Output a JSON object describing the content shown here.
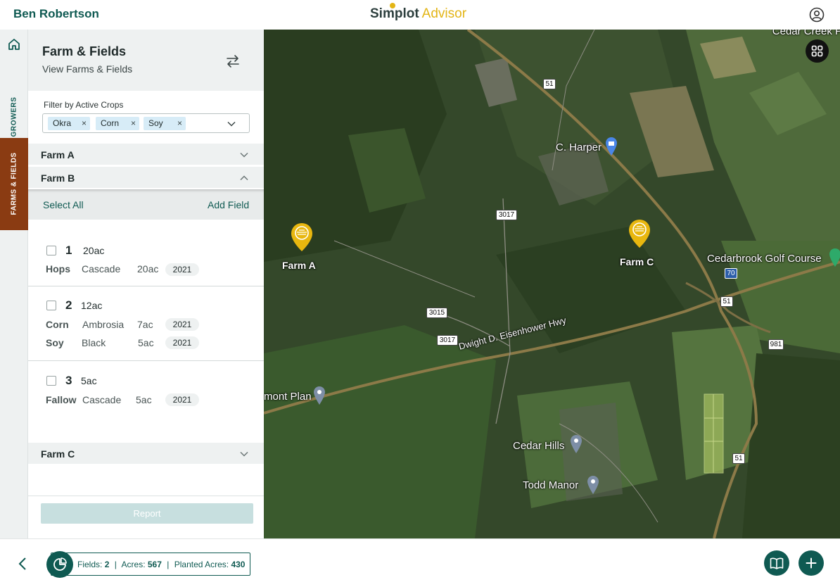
{
  "header": {
    "user_name": "Ben Robertson",
    "brand_primary": "Simplot",
    "brand_secondary": "Advisor",
    "profile_icon": "user-circle-icon"
  },
  "rail": {
    "home_icon": "home-icon",
    "growers_label": "GROWERS",
    "farms_fields_label": "FARMS & FIELDS"
  },
  "panel": {
    "title": "Farm & Fields",
    "subtitle": "View Farms & Fields",
    "swap_icon": "swap-arrows-icon",
    "filter_label": "Filter by Active Crops",
    "filter_chips": [
      "Okra",
      "Corn",
      "Soy"
    ],
    "chip_remove": "×",
    "farms": [
      {
        "name": "Farm A",
        "expanded": false
      },
      {
        "name": "Farm B",
        "expanded": true
      },
      {
        "name": "Farm C",
        "expanded": false
      }
    ],
    "select_all": "Select All",
    "add_field": "Add Field",
    "fields": [
      {
        "number": "1",
        "acres": "20ac",
        "crops": [
          {
            "crop": "Hops",
            "variety": "Cascade",
            "acres": "20ac",
            "year": "2021"
          }
        ]
      },
      {
        "number": "2",
        "acres": "12ac",
        "crops": [
          {
            "crop": "Corn",
            "variety": "Ambrosia",
            "acres": "7ac",
            "year": "2021"
          },
          {
            "crop": "Soy",
            "variety": "Black",
            "acres": "5ac",
            "year": "2021"
          }
        ]
      },
      {
        "number": "3",
        "acres": "5ac",
        "crops": [
          {
            "crop": "Fallow",
            "variety": "Cascade",
            "acres": "5ac",
            "year": "2021"
          }
        ]
      }
    ],
    "report_label": "Report"
  },
  "map": {
    "farm_markers": [
      "Farm A",
      "Farm C"
    ],
    "places": {
      "cedar_creek": "Cedar Creek P",
      "c_harper": "C. Harper",
      "cedarbrook": "Cedarbrook Golf Course",
      "mont_plan": "mont Plan",
      "cedar_hills": "Cedar Hills",
      "todd_manor": "Todd Manor"
    },
    "road_shields": [
      "51",
      "3017",
      "3015",
      "3017",
      "70",
      "51",
      "981",
      "51"
    ],
    "highway_label": "Dwight D. Eisenhower Hwy",
    "layers_icon": "grid-layers-icon",
    "marker_color": "#e8b70f"
  },
  "footer": {
    "back_icon": "chevron-left-icon",
    "stats_icon": "pie-chart-icon",
    "fields_label": "Fields:",
    "fields_value": "2",
    "acres_label": "Acres:",
    "acres_value": "567",
    "planted_label": "Planted Acres:",
    "planted_value": "430",
    "separator": "|",
    "book_icon": "book-open-icon",
    "plus_icon": "plus-icon"
  },
  "colors": {
    "brand_green": "#0f5a52",
    "active_tab": "#8a3b12",
    "brand_gold": "#e3b516"
  }
}
